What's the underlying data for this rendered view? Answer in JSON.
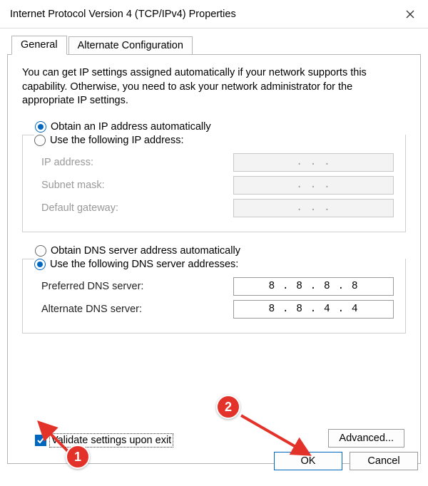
{
  "title": "Internet Protocol Version 4 (TCP/IPv4) Properties",
  "tabs": {
    "general": "General",
    "alternate": "Alternate Configuration"
  },
  "intro": "You can get IP settings assigned automatically if your network supports this capability. Otherwise, you need to ask your network administrator for the appropriate IP settings.",
  "ip_section": {
    "auto_label": "Obtain an IP address automatically",
    "auto_selected": true,
    "manual_label": "Use the following IP address:",
    "fields": {
      "ip_address_label": "IP address:",
      "subnet_label": "Subnet mask:",
      "gateway_label": "Default gateway:",
      "ip_address_value": ".       .       .",
      "subnet_value": ".       .       .",
      "gateway_value": ".       .       ."
    }
  },
  "dns_section": {
    "auto_label": "Obtain DNS server address automatically",
    "auto_selected": false,
    "manual_label": "Use the following DNS server addresses:",
    "fields": {
      "preferred_label": "Preferred DNS server:",
      "alternate_label": "Alternate DNS server:",
      "preferred_value": "8 . 8 . 8 . 8",
      "alternate_value": "8 . 8 . 4 . 4"
    }
  },
  "validate_label": "Validate settings upon exit",
  "validate_checked": true,
  "buttons": {
    "advanced": "Advanced...",
    "ok": "OK",
    "cancel": "Cancel"
  },
  "annotations": {
    "one": "1",
    "two": "2"
  }
}
